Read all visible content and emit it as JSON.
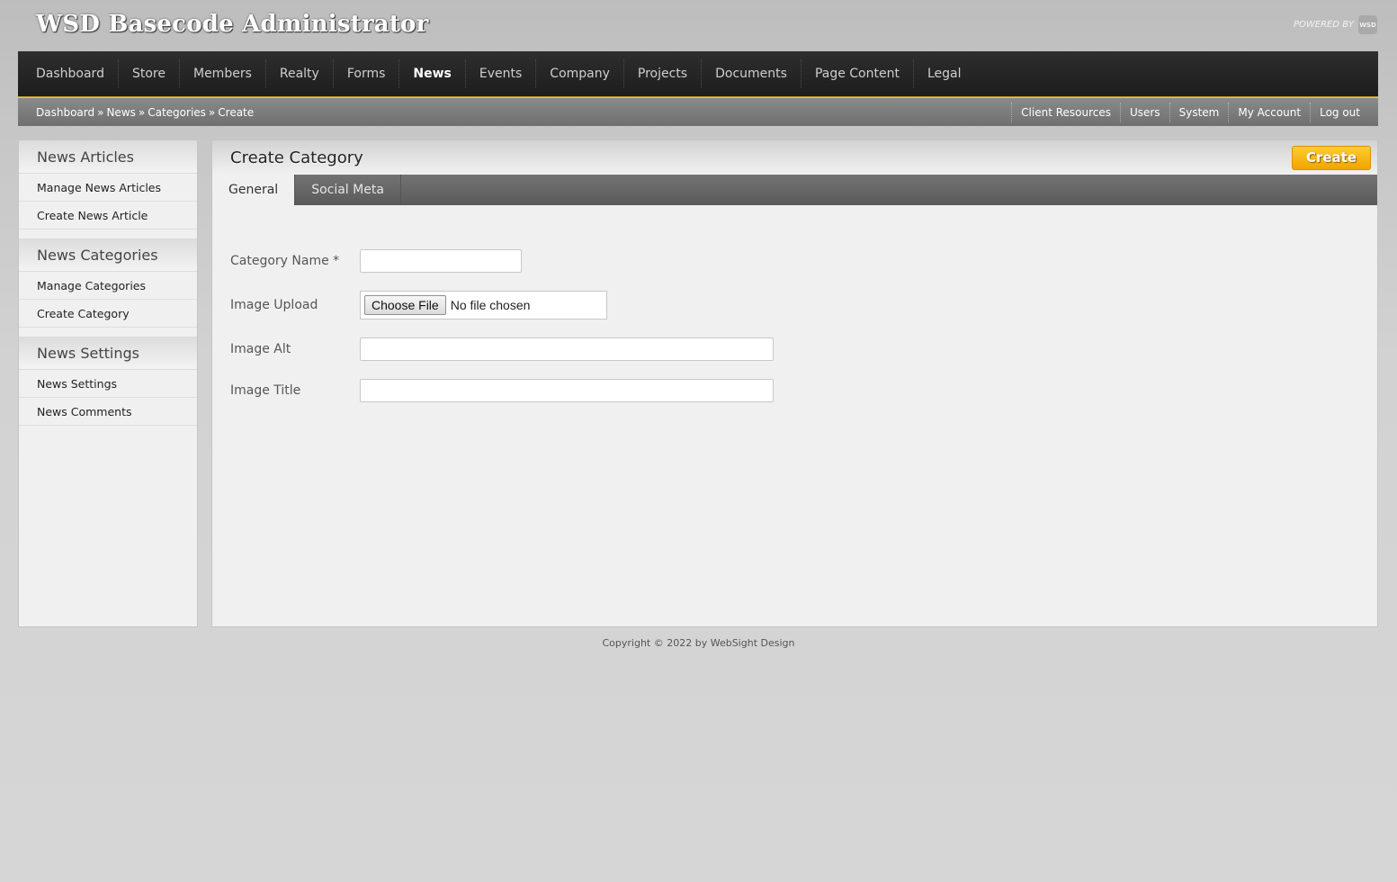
{
  "header": {
    "title": "WSD Basecode Administrator",
    "powered_by": "POWERED BY",
    "logo_text": "WSD"
  },
  "main_nav": {
    "items": [
      "Dashboard",
      "Store",
      "Members",
      "Realty",
      "Forms",
      "News",
      "Events",
      "Company",
      "Projects",
      "Documents",
      "Page Content",
      "Legal"
    ],
    "active": "News"
  },
  "breadcrumb": {
    "items": [
      "Dashboard",
      "News",
      "Categories",
      "Create"
    ],
    "separator": "»"
  },
  "utility_nav": {
    "items": [
      "Client Resources",
      "Users",
      "System",
      "My Account",
      "Log out"
    ]
  },
  "sidebar": {
    "sections": [
      {
        "heading": "News Articles",
        "links": [
          "Manage News Articles",
          "Create News Article"
        ]
      },
      {
        "heading": "News Categories",
        "links": [
          "Manage Categories",
          "Create Category"
        ]
      },
      {
        "heading": "News Settings",
        "links": [
          "News Settings",
          "News Comments"
        ]
      }
    ]
  },
  "panel": {
    "title": "Create Category",
    "create_label": "Create",
    "tabs": [
      "General",
      "Social Meta"
    ],
    "active_tab": "General"
  },
  "form": {
    "category_name_label": "Category Name *",
    "category_name_value": "",
    "image_upload_label": "Image Upload",
    "choose_file_label": "Choose File",
    "no_file_text": "No file chosen",
    "image_alt_label": "Image Alt",
    "image_alt_value": "",
    "image_title_label": "Image Title",
    "image_title_value": ""
  },
  "footer": {
    "copyright": "Copyright © 2022 by WebSight Design"
  },
  "colors": {
    "accent": "#f0a500",
    "nav_bg": "#1d1d1d",
    "subbar_bg": "#7a7a7a"
  }
}
